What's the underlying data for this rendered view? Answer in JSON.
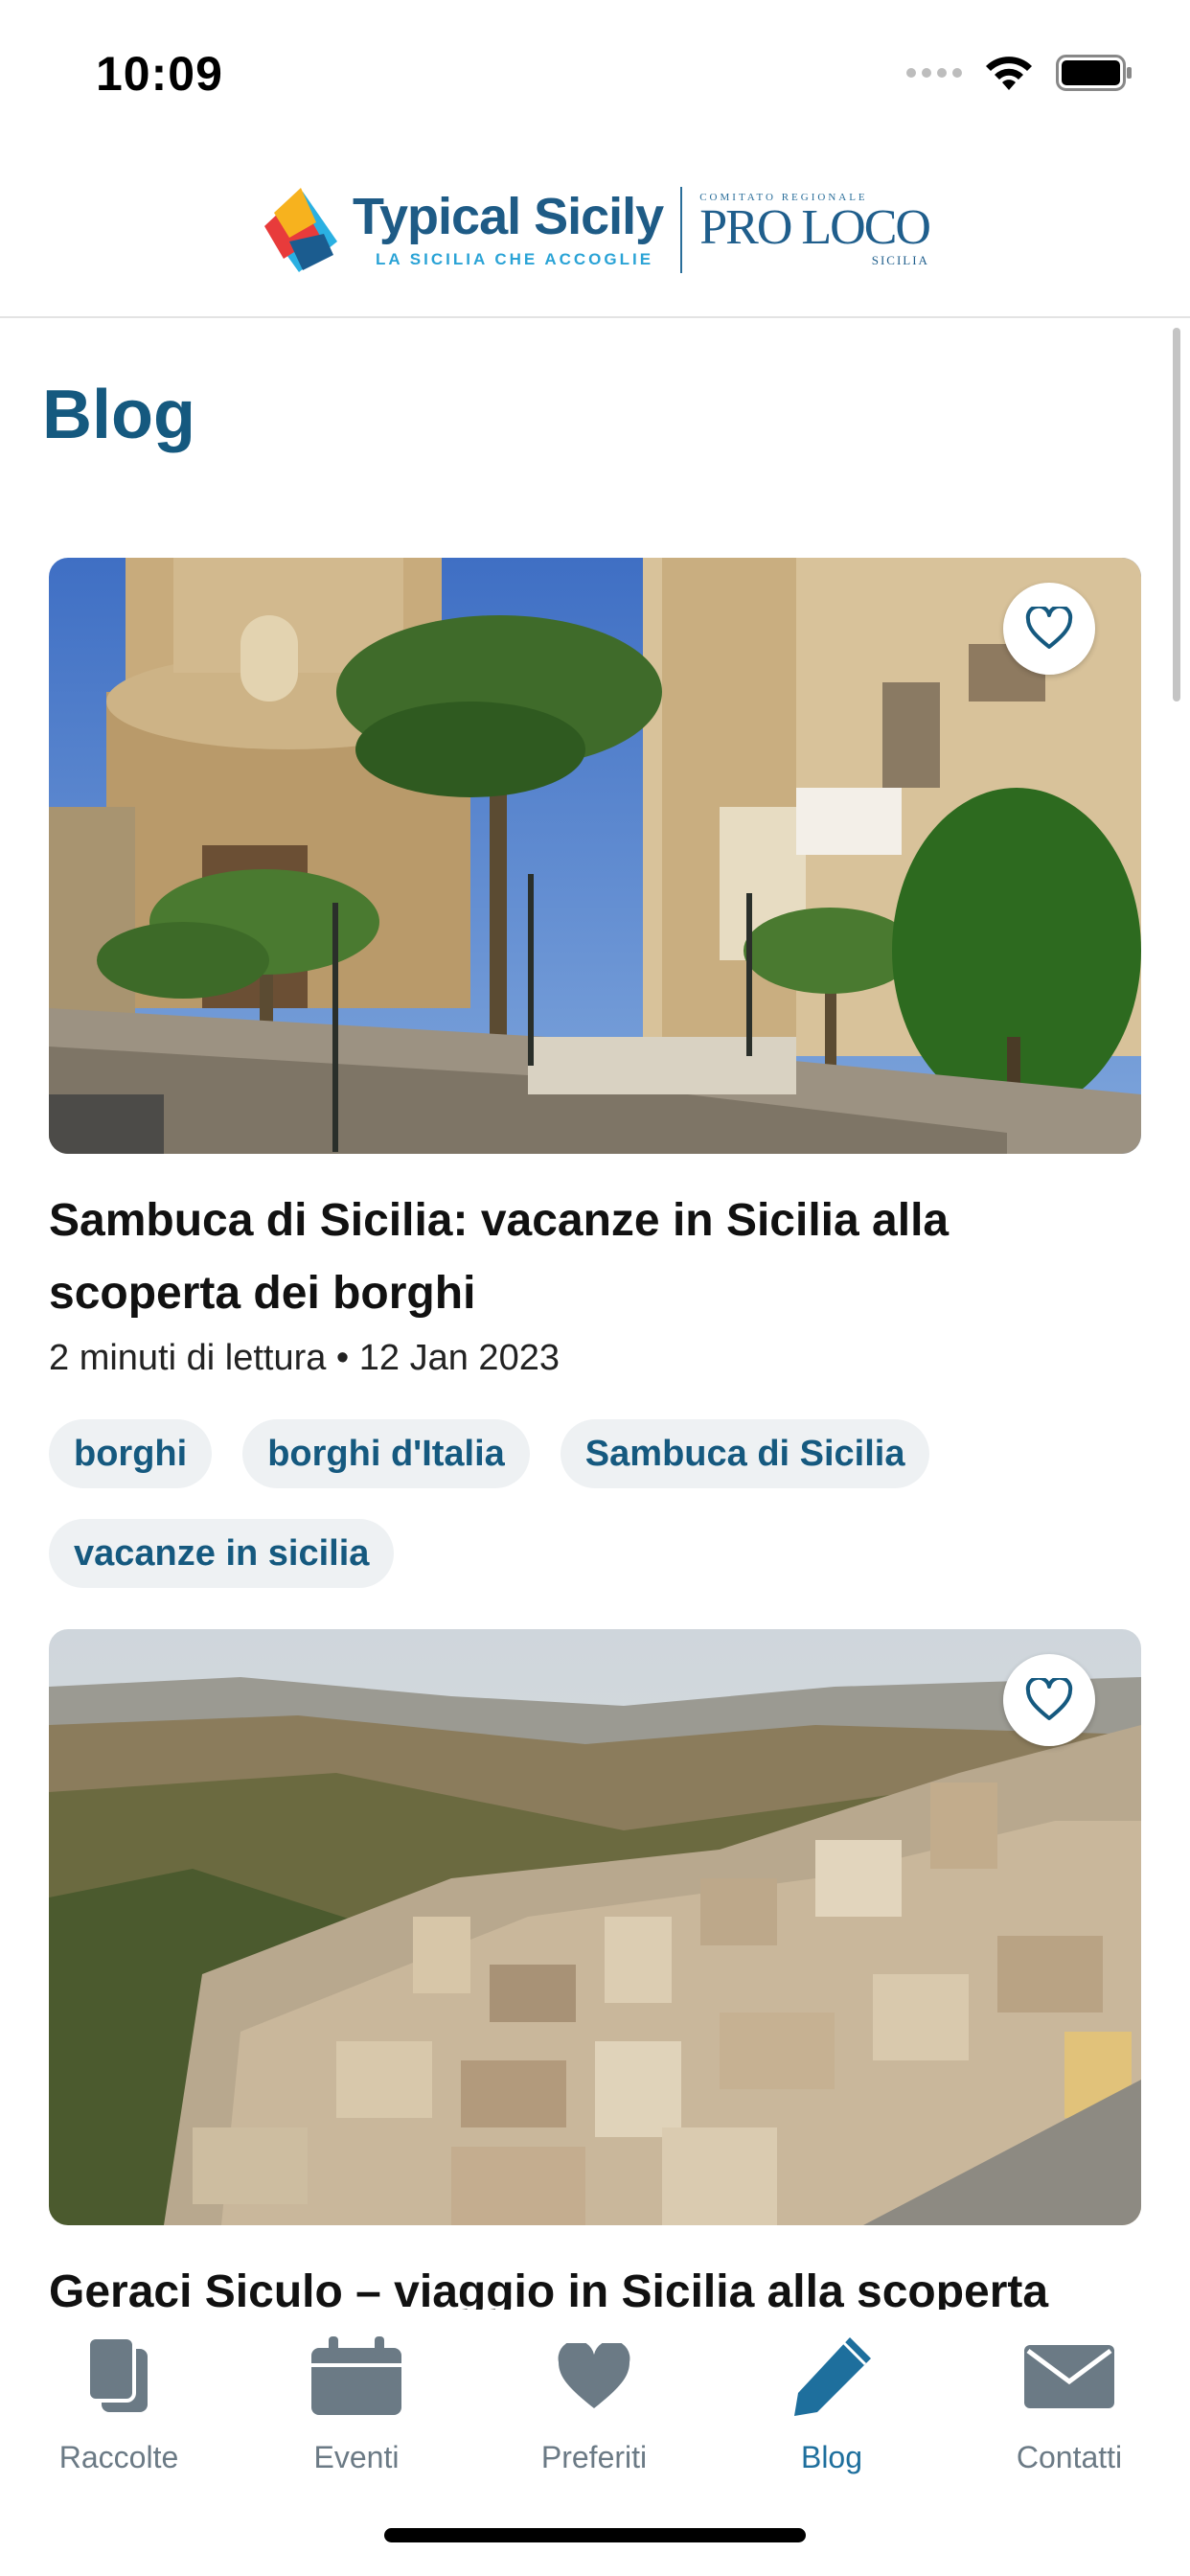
{
  "status_bar": {
    "time": "10:09"
  },
  "header": {
    "logo_brand": "Typical Sicily",
    "logo_tagline": "LA SICILIA CHE ACCOGLIE",
    "partner_top": "COMITATO REGIONALE",
    "partner_name": "PRO LOCO",
    "partner_region": "SICILIA"
  },
  "page": {
    "title": "Blog"
  },
  "posts": [
    {
      "title": "Sambuca di Sicilia: vacanze in Sicilia alla scoperta dei borghi",
      "meta": "2 minuti di lettura • 12 Jan 2023",
      "tags": [
        "borghi",
        "borghi d'Italia",
        "Sambuca di Sicilia",
        "vacanze in sicilia"
      ]
    },
    {
      "title": "Geraci Siculo – viaggio in Sicilia alla scoperta"
    }
  ],
  "tab_bar": {
    "items": [
      {
        "label": "Raccolte",
        "icon": "collections-icon"
      },
      {
        "label": "Eventi",
        "icon": "calendar-icon"
      },
      {
        "label": "Preferiti",
        "icon": "heart-icon"
      },
      {
        "label": "Blog",
        "icon": "pencil-icon"
      },
      {
        "label": "Contatti",
        "icon": "envelope-icon"
      }
    ],
    "active": "Blog",
    "active_color": "#1e6f9d",
    "inactive_color": "#6b7a85"
  },
  "colors": {
    "accent": "#15597f",
    "tag_bg": "#eef1f3"
  }
}
